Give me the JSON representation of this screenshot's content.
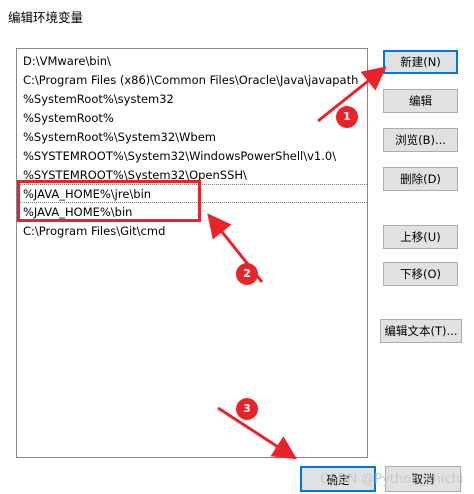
{
  "window": {
    "title": "编辑环境变量"
  },
  "path_list": {
    "items": [
      "D:\\VMware\\bin\\",
      "C:\\Program Files (x86)\\Common Files\\Oracle\\Java\\javapath",
      "%SystemRoot%\\system32",
      "%SystemRoot%",
      "%SystemRoot%\\System32\\Wbem",
      "%SYSTEMROOT%\\System32\\WindowsPowerShell\\v1.0\\",
      "%SYSTEMROOT%\\System32\\OpenSSH\\",
      "%JAVA_HOME%\\jre\\bin",
      "%JAVA_HOME%\\bin",
      "C:\\Program Files\\Git\\cmd"
    ]
  },
  "buttons": {
    "new": "新建(N)",
    "edit": "编辑",
    "browse": "浏览(B)...",
    "delete": "删除(D)",
    "move_up": "上移(U)",
    "move_down": "下移(O)",
    "edit_text": "编辑文本(T)...",
    "ok": "确定",
    "cancel": "取消"
  },
  "annotations": {
    "step1": "1",
    "step2": "2",
    "step3": "3",
    "accent_color": "#e8232a"
  },
  "watermark": "CSDN @Python_shichi"
}
